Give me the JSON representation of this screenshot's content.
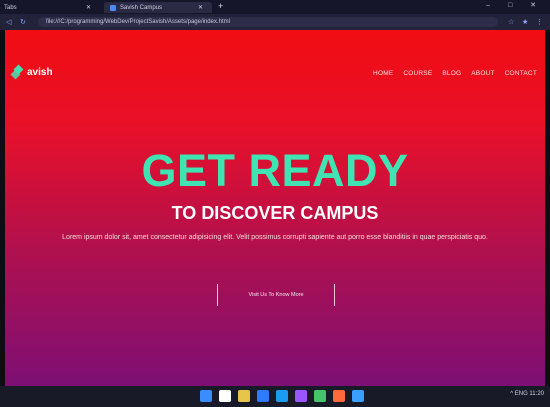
{
  "browser": {
    "tabs": [
      {
        "label": "Tabs"
      },
      {
        "label": "Savish Campus"
      }
    ],
    "new_tab": "+",
    "window_controls": "–  □  ✕",
    "nav": {
      "back": "◁",
      "reload": "↻"
    },
    "address": "file:///C:/programming/WebDev/ProjectSavish/Assets/page/index.html",
    "extensions": [
      "☆",
      "★",
      "⋮"
    ]
  },
  "site": {
    "logo_text": "avish",
    "nav": [
      "HOME",
      "COURSE",
      "BLOG",
      "ABOUT",
      "CONTACT"
    ]
  },
  "hero": {
    "title": "GET READY",
    "subtitle": "TO DISCOVER CAMPUS",
    "text": "Lorem ipsum dolor sit, amet consectetur adipisicing elit. Velit possimus corrupti sapiente aut porro esse blanditiis in quae perspiciatis quo.",
    "cta": "Visit Us To Know More"
  },
  "taskbar": {
    "tray_text": "^  ENG  11:20",
    "icon_colors": [
      "#3a8dff",
      "#ffffff",
      "#e7c44a",
      "#2f7bff",
      "#1a9df1",
      "#9b55ff",
      "#45c66b",
      "#ff6a3d",
      "#3aa0ff"
    ]
  }
}
